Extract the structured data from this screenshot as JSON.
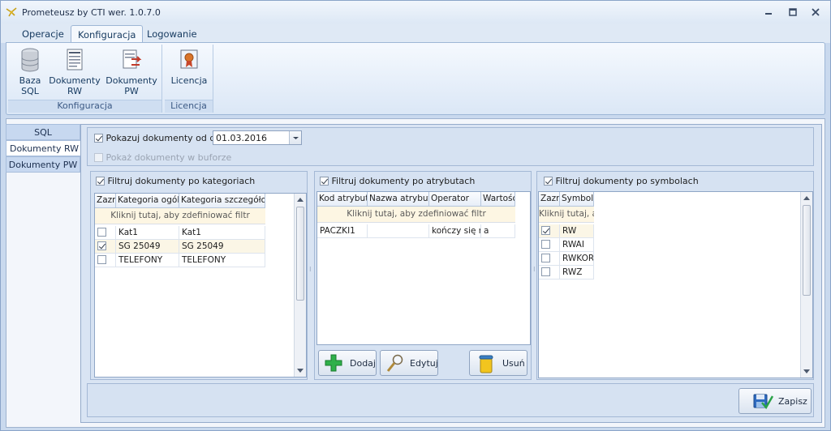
{
  "window": {
    "title": "Prometeusz by CTI  wer. 1.0.7.0"
  },
  "ribbon": {
    "tabs": [
      {
        "label": "Operacje"
      },
      {
        "label": "Konfiguracja"
      },
      {
        "label": "Logowanie"
      }
    ],
    "groups": {
      "konfiguracja": {
        "caption": "Konfiguracja",
        "buttons": [
          {
            "line1": "Baza",
            "line2": "SQL",
            "icon": "database-icon"
          },
          {
            "line1": "Dokumenty",
            "line2": "RW",
            "icon": "document-list-icon"
          },
          {
            "line1": "Dokumenty",
            "line2": "PW",
            "icon": "document-transfer-icon"
          }
        ]
      },
      "licencja": {
        "caption": "Licencja",
        "buttons": [
          {
            "line1": "Licencja",
            "icon": "certificate-icon"
          }
        ]
      }
    }
  },
  "side_tabs": [
    {
      "label": "SQL"
    },
    {
      "label": "Dokumenty RW"
    },
    {
      "label": "Dokumenty PW"
    }
  ],
  "top": {
    "show_from_label": "Pokazuj dokumenty od dnia",
    "show_from_checked": true,
    "date_value": "01.03.2016",
    "buffer_label": "Pokaż dokumenty w buforze",
    "buffer_checked": false
  },
  "categories": {
    "header_label": "Filtruj dokumenty po kategoriach",
    "checked": true,
    "columns": [
      "Zazn",
      "Kategoria ogólna",
      "Kategoria szczegółowa"
    ],
    "filter_hint": "Kliknij tutaj, aby zdefiniować filtr",
    "rows": [
      {
        "selected": false,
        "general": "Kat1",
        "detail": "Kat1"
      },
      {
        "selected": true,
        "general": "SG 25049",
        "detail": "SG 25049"
      },
      {
        "selected": false,
        "general": "TELEFONY",
        "detail": "TELEFONY"
      }
    ]
  },
  "attributes": {
    "header_label": "Filtruj dokumenty po atrybutach",
    "checked": true,
    "columns": [
      "Kod atrybutu",
      "Nazwa atrybutu",
      "Operator",
      "Wartość"
    ],
    "filter_hint": "Kliknij tutaj, aby zdefiniować filtr",
    "rows": [
      {
        "code": "PACZKI1",
        "name": "",
        "operator": "kończy się na",
        "value": "a"
      }
    ],
    "buttons": {
      "add": "Dodaj",
      "edit": "Edytuj",
      "delete": "Usuń"
    }
  },
  "symbols": {
    "header_label": "Filtruj dokumenty po symbolach",
    "checked": true,
    "columns": [
      "Zazn",
      "Symbol"
    ],
    "filter_hint": "Kliknij tutaj, aby zdefiniować filtr",
    "rows": [
      {
        "selected": true,
        "symbol": "RW"
      },
      {
        "selected": false,
        "symbol": "RWAI"
      },
      {
        "selected": false,
        "symbol": "RWKOR"
      },
      {
        "selected": false,
        "symbol": "RWZ"
      }
    ]
  },
  "footer": {
    "save_label": "Zapisz"
  },
  "colors": {
    "accent": "#15395f",
    "filter_row_bg": "#fdf6e3"
  }
}
